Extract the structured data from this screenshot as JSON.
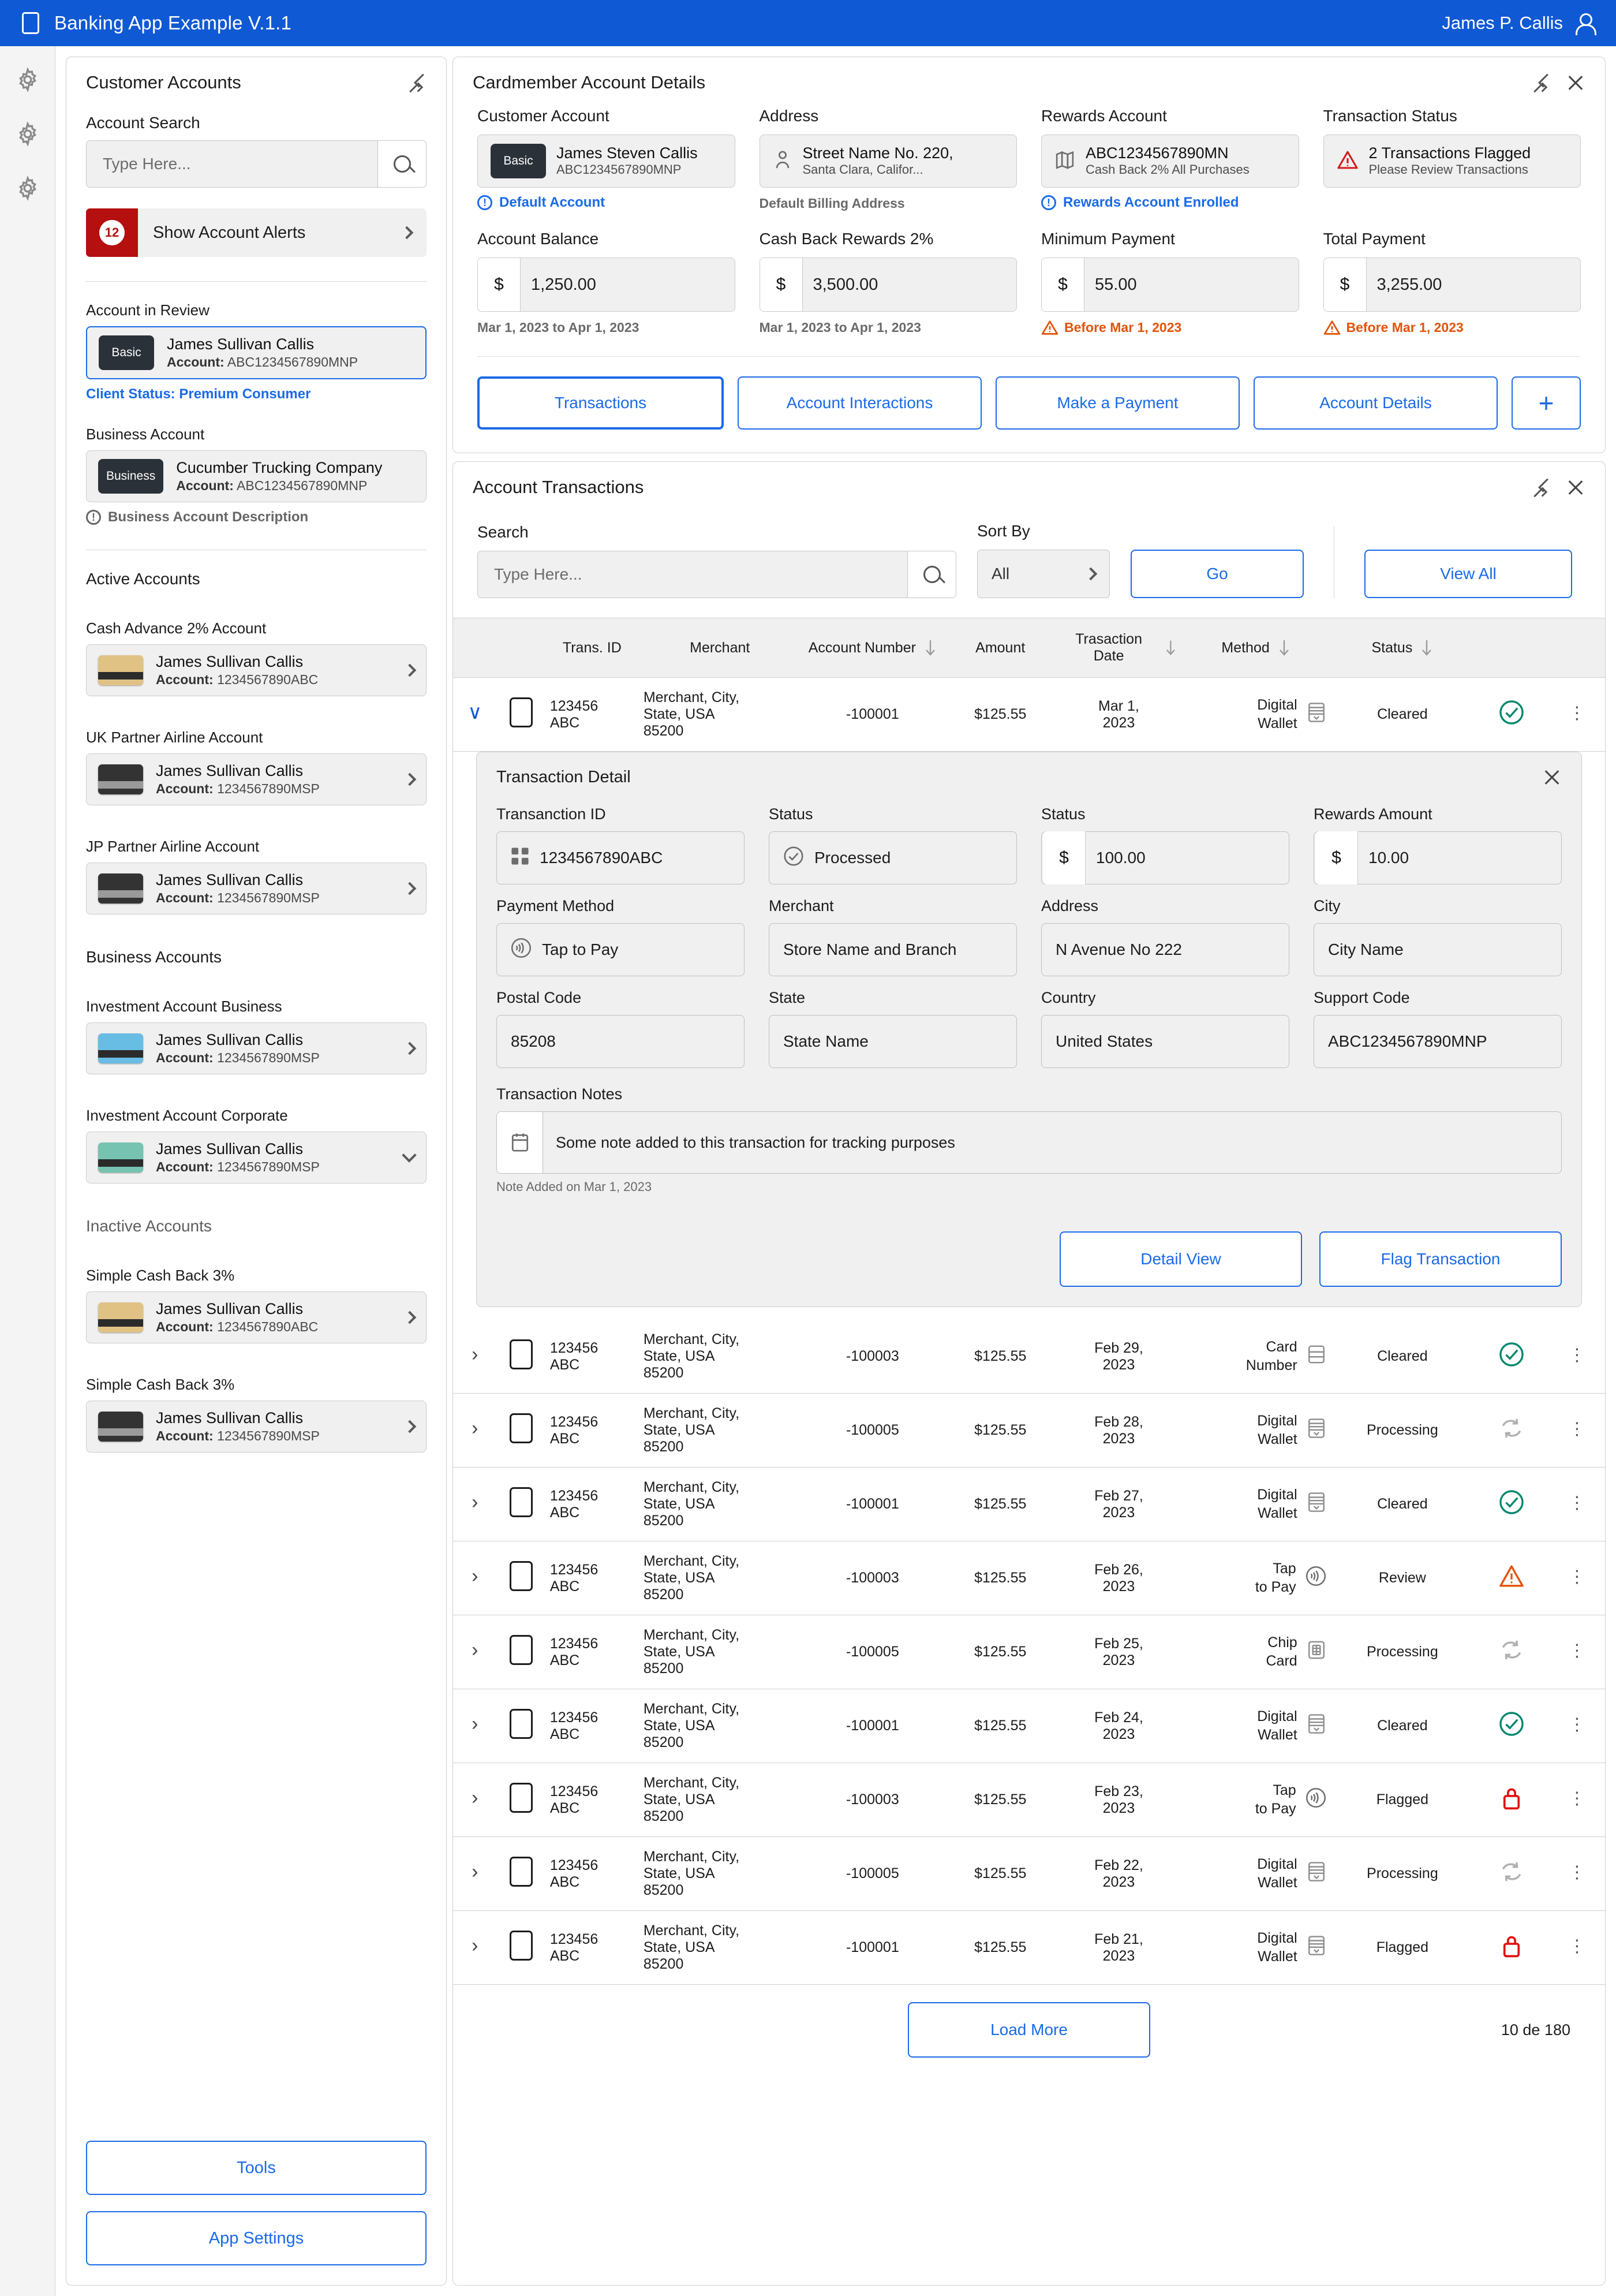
{
  "titlebar": {
    "app_title": "Banking App Example V.1.1",
    "user_name": "James P. Callis",
    "brand_color": "#1059d4"
  },
  "sidebar": {
    "panel_title": "Customer Accounts",
    "search": {
      "label": "Account Search",
      "placeholder": "Type Here...",
      "value": ""
    },
    "alerts": {
      "count": "12",
      "label": "Show Account Alerts"
    },
    "review": {
      "section_label": "Account in Review",
      "chip": "Basic",
      "name": "James Sullivan Callis",
      "account_prefix": "Account:",
      "account_number": "ABC1234567890MNP",
      "status_note": "Client Status: Premium Consumer"
    },
    "business": {
      "section_label": "Business Account",
      "chip": "Business",
      "name": "Cucumber Trucking Company",
      "account_prefix": "Account:",
      "account_number": "ABC1234567890MNP",
      "note": "Business Account Description"
    },
    "active_label": "Active Accounts",
    "active_accounts": [
      {
        "group": "Cash Advance 2% Account",
        "name": "James Sullivan Callis",
        "account_prefix": "Account:",
        "account_number": "1234567890ABC",
        "card_top": "#e0c285",
        "card_stripe": "#2b2b2b",
        "chevron": "right"
      },
      {
        "group": "UK Partner Airline Account",
        "name": "James Sullivan Callis",
        "account_prefix": "Account:",
        "account_number": "1234567890MSP",
        "card_top": "#333333",
        "card_stripe": "#9a9a9a",
        "chevron": "right"
      },
      {
        "group": "JP Partner Airline Account",
        "name": "James Sullivan Callis",
        "account_prefix": "Account:",
        "account_number": "1234567890MSP",
        "card_top": "#333333",
        "card_stripe": "#9a9a9a",
        "chevron": "right"
      }
    ],
    "business_label": "Business Accounts",
    "business_accounts": [
      {
        "group": "Investment Account Business",
        "name": "James Sullivan Callis",
        "account_prefix": "Account:",
        "account_number": "1234567890MSP",
        "card_top": "#68bde4",
        "card_stripe": "#2b2b2b",
        "chevron": "right"
      },
      {
        "group": "Investment Account Corporate",
        "name": "James Sullivan Callis",
        "account_prefix": "Account:",
        "account_number": "1234567890MSP",
        "card_top": "#75c3b0",
        "card_stripe": "#2b2b2b",
        "chevron": "down"
      }
    ],
    "inactive_label": "Inactive Accounts",
    "inactive_accounts": [
      {
        "group": "Simple Cash Back 3%",
        "name": "James Sullivan Callis",
        "account_prefix": "Account:",
        "account_number": "1234567890ABC",
        "card_top": "#e0c285",
        "card_stripe": "#2b2b2b",
        "chevron": "right"
      },
      {
        "group": "Simple Cash Back 3%",
        "name": "James Sullivan Callis",
        "account_prefix": "Account:",
        "account_number": "1234567890MSP",
        "card_top": "#333333",
        "card_stripe": "#9a9a9a",
        "chevron": "right"
      }
    ],
    "tools_label": "Tools",
    "settings_label": "App Settings"
  },
  "details": {
    "panel_title": "Cardmember Account Details",
    "fields": [
      {
        "label": "Customer Account",
        "chip": "Basic",
        "value": "James Steven Callis",
        "sub": "ABC1234567890MNP",
        "caption": "Default Account",
        "caption_style": "blue-info"
      },
      {
        "label": "Address",
        "icon": "person-icon",
        "value": "Street Name No. 220,",
        "sub": "Santa Clara, Califor...",
        "caption": "Default Billing Address",
        "caption_style": "gray"
      },
      {
        "label": "Rewards Account",
        "icon": "map-icon",
        "value": "ABC1234567890MN",
        "sub": "Cash Back 2% All Purchases",
        "caption": "Rewards Account Enrolled",
        "caption_style": "blue-info"
      },
      {
        "label": "Transaction Status",
        "icon": "warning-icon",
        "value": "2 Transactions Flagged",
        "sub": "Please Review Transactions",
        "caption": "",
        "caption_style": "none"
      }
    ],
    "amounts": [
      {
        "label": "Account Balance",
        "prefix": "$",
        "value": "1,250.00",
        "caption": "Mar 1, 2023 to Apr 1, 2023",
        "caption_style": "gray"
      },
      {
        "label": "Cash Back Rewards 2%",
        "prefix": "$",
        "value": "3,500.00",
        "caption": "Mar 1, 2023 to Apr 1, 2023",
        "caption_style": "gray"
      },
      {
        "label": "Minimum Payment",
        "prefix": "$",
        "value": "55.00",
        "caption": "Before Mar 1, 2023",
        "caption_style": "warn"
      },
      {
        "label": "Total Payment",
        "prefix": "$",
        "value": "3,255.00",
        "caption": "Before Mar 1, 2023",
        "caption_style": "warn"
      }
    ],
    "actions": [
      {
        "label": "Transactions",
        "active": true
      },
      {
        "label": "Account Interactions",
        "active": false
      },
      {
        "label": "Make a Payment",
        "active": false
      },
      {
        "label": "Account Details",
        "active": false
      },
      {
        "label": "+",
        "active": false,
        "kind": "plus"
      }
    ]
  },
  "transactions": {
    "panel_title": "Account Transactions",
    "search": {
      "label": "Search",
      "placeholder": "Type Here...",
      "value": ""
    },
    "sort": {
      "label": "Sort By",
      "value": "All"
    },
    "go_label": "Go",
    "view_all_label": "View All",
    "columns": [
      "Trans. ID",
      "Merchant",
      "Account Number",
      "Amount",
      "Trasaction Date",
      "Method",
      "Status"
    ],
    "rows": [
      {
        "id": "123456 ABC",
        "merchant": "Merchant, City, State, USA 85200",
        "account": "-100001",
        "amount": "$125.55",
        "date": "Mar 1, 2023",
        "method": "Digital Wallet",
        "method_icon": "wallet-icon",
        "status": "Cleared",
        "badge": "check",
        "expanded": true
      },
      {
        "id": "123456 ABC",
        "merchant": "Merchant, City, State, USA 85200",
        "account": "-100003",
        "amount": "$125.55",
        "date": "Feb 29, 2023",
        "method": "Card Number",
        "method_icon": "card-icon",
        "status": "Cleared",
        "badge": "check",
        "expanded": false
      },
      {
        "id": "123456 ABC",
        "merchant": "Merchant, City, State, USA 85200",
        "account": "-100005",
        "amount": "$125.55",
        "date": "Feb 28, 2023",
        "method": "Digital Wallet",
        "method_icon": "wallet-icon",
        "status": "Processing",
        "badge": "sync",
        "expanded": false
      },
      {
        "id": "123456 ABC",
        "merchant": "Merchant, City, State, USA 85200",
        "account": "-100001",
        "amount": "$125.55",
        "date": "Feb 27, 2023",
        "method": "Digital Wallet",
        "method_icon": "wallet-icon",
        "status": "Cleared",
        "badge": "check",
        "expanded": false
      },
      {
        "id": "123456 ABC",
        "merchant": "Merchant, City, State, USA 85200",
        "account": "-100003",
        "amount": "$125.55",
        "date": "Feb 26, 2023",
        "method": "Tap to Pay",
        "method_icon": "contactless-icon",
        "status": "Review",
        "badge": "warn",
        "expanded": false
      },
      {
        "id": "123456 ABC",
        "merchant": "Merchant, City, State, USA 85200",
        "account": "-100005",
        "amount": "$125.55",
        "date": "Feb 25, 2023",
        "method": "Chip Card",
        "method_icon": "chip-icon",
        "status": "Processing",
        "badge": "sync",
        "expanded": false
      },
      {
        "id": "123456 ABC",
        "merchant": "Merchant, City, State, USA 85200",
        "account": "-100001",
        "amount": "$125.55",
        "date": "Feb 24, 2023",
        "method": "Digital Wallet",
        "method_icon": "wallet-icon",
        "status": "Cleared",
        "badge": "check",
        "expanded": false
      },
      {
        "id": "123456 ABC",
        "merchant": "Merchant, City, State, USA 85200",
        "account": "-100003",
        "amount": "$125.55",
        "date": "Feb 23, 2023",
        "method": "Tap to Pay",
        "method_icon": "contactless-icon",
        "status": "Flagged",
        "badge": "lock",
        "expanded": false
      },
      {
        "id": "123456 ABC",
        "merchant": "Merchant, City, State, USA 85200",
        "account": "-100005",
        "amount": "$125.55",
        "date": "Feb 22, 2023",
        "method": "Digital Wallet",
        "method_icon": "wallet-icon",
        "status": "Processing",
        "badge": "sync",
        "expanded": false
      },
      {
        "id": "123456 ABC",
        "merchant": "Merchant, City, State, USA 85200",
        "account": "-100001",
        "amount": "$125.55",
        "date": "Feb 21, 2023",
        "method": "Digital Wallet",
        "method_icon": "wallet-icon",
        "status": "Flagged",
        "badge": "lock",
        "expanded": false
      }
    ],
    "load_more_label": "Load More",
    "pager_text": "10 de 180"
  },
  "transaction_detail": {
    "title": "Transaction Detail",
    "fields": [
      {
        "label": "Transanction ID",
        "value": "1234567890ABC",
        "icon": "grid-icon"
      },
      {
        "label": "Status",
        "value": "Processed",
        "icon": "check-circle-icon"
      },
      {
        "label": "Status",
        "value": "100.00",
        "prefix": "$"
      },
      {
        "label": "Rewards Amount",
        "value": "10.00",
        "prefix": "$"
      },
      {
        "label": "Payment Method",
        "value": "Tap to Pay",
        "icon": "contactless-icon"
      },
      {
        "label": "Merchant",
        "value": "Store Name and Branch"
      },
      {
        "label": "Address",
        "value": "N Avenue No 222"
      },
      {
        "label": "City",
        "value": "City Name"
      },
      {
        "label": "Postal Code",
        "value": "85208"
      },
      {
        "label": "State",
        "value": "State Name"
      },
      {
        "label": "Country",
        "value": "United States"
      },
      {
        "label": "Support Code",
        "value": "ABC1234567890MNP"
      }
    ],
    "notes_label": "Transaction Notes",
    "notes_value": "Some note added to this transaction for tracking purposes",
    "notes_caption": "Note Added on Mar 1, 2023",
    "detail_view_label": "Detail View",
    "flag_label": "Flag Transaction"
  },
  "colors": {
    "accent": "#1a6ae8",
    "brand": "#1059d4",
    "danger": "#b50f0f",
    "warn": "#e2530a",
    "success": "#00876c"
  }
}
